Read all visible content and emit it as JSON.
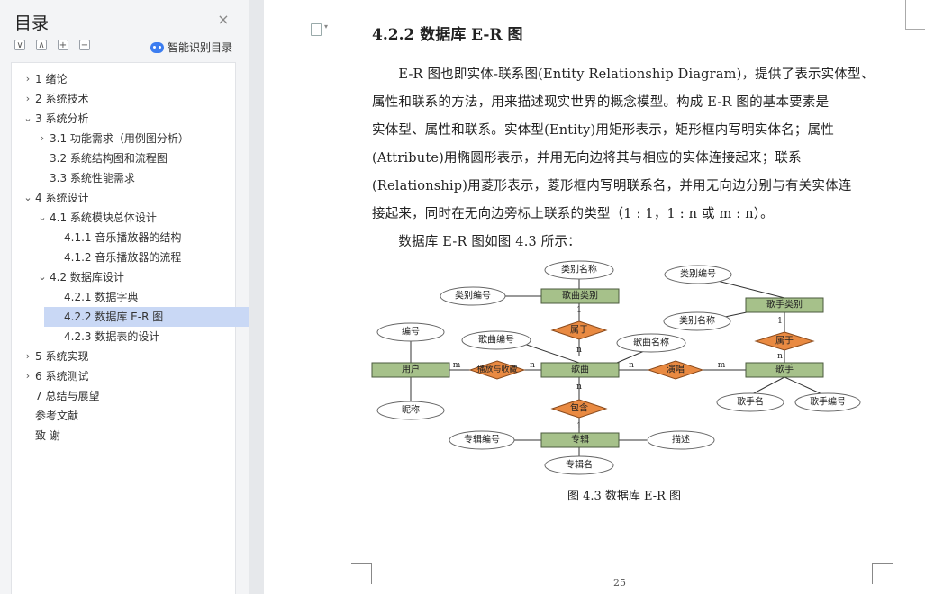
{
  "sidebar": {
    "title": "目录",
    "close_glyph": "×",
    "toolbar": {
      "collapse_all": "∨",
      "expand_all": "∧",
      "add": "+",
      "remove": "−"
    },
    "ai_toc_label": "智能识别目录",
    "toc": [
      {
        "label": "1 绪论",
        "level": 1,
        "arrow": "›"
      },
      {
        "label": "2 系统技术",
        "level": 1,
        "arrow": "›"
      },
      {
        "label": "3 系统分析",
        "level": 1,
        "arrow": "⌄"
      },
      {
        "label": "3.1  功能需求（用例图分析）",
        "level": 2,
        "arrow": "›"
      },
      {
        "label": "3.2  系统结构图和流程图",
        "level": 2,
        "arrow": ""
      },
      {
        "label": "3.3  系统性能需求",
        "level": 2,
        "arrow": ""
      },
      {
        "label": "4 系统设计",
        "level": 1,
        "arrow": "⌄"
      },
      {
        "label": "4.1  系统模块总体设计",
        "level": 2,
        "arrow": "⌄"
      },
      {
        "label": "4.1.1  音乐播放器的结构",
        "level": 3,
        "arrow": ""
      },
      {
        "label": "4.1.2  音乐播放器的流程",
        "level": 3,
        "arrow": ""
      },
      {
        "label": "4.2  数据库设计",
        "level": 2,
        "arrow": "⌄"
      },
      {
        "label": "4.2.1  数据字典",
        "level": 3,
        "arrow": ""
      },
      {
        "label": "4.2.2  数据库 E-R 图",
        "level": 3,
        "arrow": "",
        "active": true
      },
      {
        "label": "4.2.3  数据表的设计",
        "level": 3,
        "arrow": ""
      },
      {
        "label": "5 系统实现",
        "level": 1,
        "arrow": "›"
      },
      {
        "label": "6 系统测试",
        "level": 1,
        "arrow": "›"
      },
      {
        "label": "7 总结与展望",
        "level": 1,
        "arrow": ""
      },
      {
        "label": "参考文献",
        "level": 1,
        "arrow": ""
      },
      {
        "label": "致    谢",
        "level": 1,
        "arrow": ""
      }
    ]
  },
  "document": {
    "heading": "4.2.2  数据库 E-R 图",
    "paragraph1_lines": [
      "　　E-R 图也即实体-联系图(Entity Relationship Diagram)，提供了表示实体型、",
      "属性和联系的方法，用来描述现实世界的概念模型。构成 E-R 图的基本要素是",
      "实体型、属性和联系。实体型(Entity)用矩形表示，矩形框内写明实体名；属性",
      "(Attribute)用椭圆形表示，并用无向边将其与相应的实体连接起来；联系",
      "(Relationship)用菱形表示，菱形框内写明联系名，并用无向边分别与有关实体连",
      "接起来，同时在无向边旁标上联系的类型（1 : 1，1 : n 或 m : n）。"
    ],
    "paragraph2": "　　数据库 E-R 图如图 4.3 所示：",
    "caption": "图 4.3 数据库 E-R 图",
    "page_number": "25"
  },
  "er_diagram": {
    "entities": {
      "user": "用户",
      "song": "歌曲",
      "song_category": "歌曲类别",
      "singer": "歌手",
      "singer_category": "歌手类别",
      "album": "专辑"
    },
    "relationships": {
      "play_collect": "播放与收藏",
      "belongs_song": "属于",
      "perform": "演唱",
      "belongs_singer": "属于",
      "contains": "包含"
    },
    "attributes": {
      "user_id": "编号",
      "user_nick": "昵称",
      "category_id": "类别编号",
      "category_name": "类别名称",
      "song_id": "歌曲编号",
      "song_name": "歌曲名称",
      "singer_cat_id": "类别编号",
      "singer_cat_name": "类别名称",
      "singer_name": "歌手名",
      "singer_id": "歌手编号",
      "album_id": "专辑编号",
      "album_desc": "描述",
      "album_name": "专辑名"
    },
    "cardinalities": {
      "m": "m",
      "n": "n",
      "one": "1"
    }
  }
}
